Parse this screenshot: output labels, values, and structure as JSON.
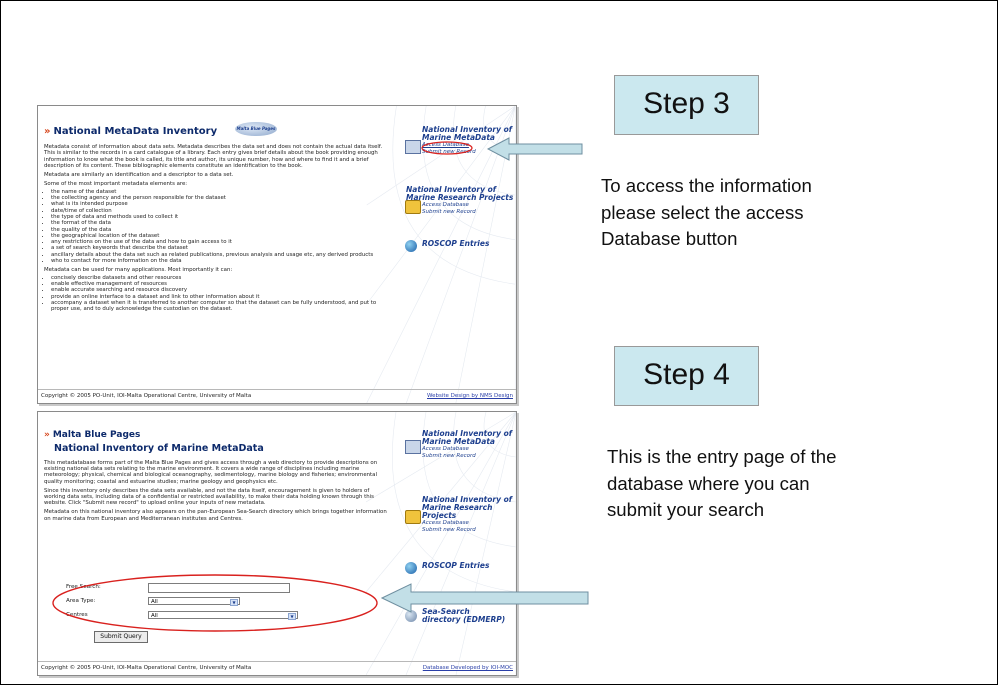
{
  "step3": {
    "label": "Step 3",
    "description": [
      "To access the information",
      "please select the access",
      "Database button"
    ]
  },
  "step4": {
    "label": "Step 4",
    "description": [
      "This is the entry page of the",
      "database where you can",
      "submit your search"
    ]
  },
  "screenshot1": {
    "heading": "National MetaData Inventory",
    "logo_text": "Malta Blue Pages",
    "paragraph1": "Metadata consist of information about data sets. Metadata describes the data set and does not contain the actual data itself. This is similar to the records in a card catalogue of a library. Each entry gives brief details about the book providing enough information to know what the book is called, its title and author, its unique number, how and where to find it and a brief description of its content. These bibliographic elements constitute an identification to the book.",
    "paragraph2": "Metadata are similarly an identification and a descriptor to a data set.",
    "paragraph3": "Some of the most important metadata elements are:",
    "elements": [
      "the name of the dataset",
      "the collecting agency and the person responsible for the dataset",
      "what is its intended purpose",
      "date/time of collection",
      "the type of data and methods used to collect it",
      "the format of the data",
      "the quality of the data",
      "the geographical location of the dataset",
      "any restrictions on the use of the data and how to gain access to it",
      "a set of search keywords that describe the dataset",
      "ancillary details about the data set such as related publications, previous analysis and usage etc, any derived products",
      "who to contact for more information on the data"
    ],
    "paragraph4": "Metadata can be used for many applications. Most importantly it can:",
    "uses": [
      "concisely describe datasets and other resources",
      "enable effective management of resources",
      "enable accurate searching and resource discovery",
      "provide an online interface to a dataset and link to other information about it",
      "accompany a dataset when it is transferred to another computer so that the dataset can be fully understood, and put to proper use, and to duly acknowledge the custodian on the dataset."
    ],
    "side": {
      "marine_title": "National Inventory of Marine MetaData",
      "access_db": "Access Database",
      "submit_new": "Submit new Record",
      "research_title": "National Inventory of Marine Research Projects",
      "access_db2": "Access Database",
      "submit_new2": "Submit new Record",
      "roscop": "ROSCOP Entries"
    },
    "footer_left": "Copyright © 2005 PO-Unit, IOI-Malta Operational Centre, University of Malta",
    "footer_right": "Website Design by NMS Design"
  },
  "screenshot2": {
    "heading1": "Malta Blue Pages",
    "heading2": "National Inventory of Marine MetaData",
    "paragraph1": "This metadatabase forms part of the Malta Blue Pages and gives access through a web directory to provide descriptions on existing national data sets relating to the marine environment. It covers a wide range of disciplines including marine meteorology; physical, chemical and biological oceanography, sedimentology, marine biology and fisheries; environmental quality monitoring; coastal and estuarine studies; marine geology and geophysics etc.",
    "paragraph2": "Since this inventory only describes the data sets available, and not the data itself, encouragement is given to holders of working data sets, including data of a confidential or restricted availability, to make their data holding known through this website. Click \"Submit new record\" to upload online your inputs of new metadata.",
    "paragraph3": "Metadata on this national inventory also appears on the pan-European Sea-Search directory which brings together information on marine data from European and Mediterranean institutes and Centres.",
    "form": {
      "free_search_label": "Free Search:",
      "free_search_value": "",
      "area_type_label": "Area Type:",
      "area_type_value": "All",
      "centres_label": "Centres",
      "centres_value": "All",
      "submit_label": "Submit Query"
    },
    "side": {
      "marine_title": "National Inventory of Marine MetaData",
      "access_db": "Access Database",
      "submit_new": "Submit new Record",
      "research_title": "National Inventory of Marine Research Projects",
      "access_db2": "Access Database",
      "submit_new2": "Submit new Record",
      "roscop": "ROSCOP Entries",
      "edmerp_1": "Sea-Search",
      "edmerp_2": "directory (EDMERP)"
    },
    "footer_left": "Copyright © 2005 PO-Unit, IOI-Malta Operational Centre, University of Malta",
    "footer_right": "Database Developed by IOI-MOC"
  },
  "colors": {
    "step_box": "#cbe8ef",
    "arrow_fill": "#c2dfe7",
    "arrow_stroke": "#6f8fa0",
    "highlight_ellipse": "#d9211e",
    "heading_blue": "#0d2a6b"
  }
}
